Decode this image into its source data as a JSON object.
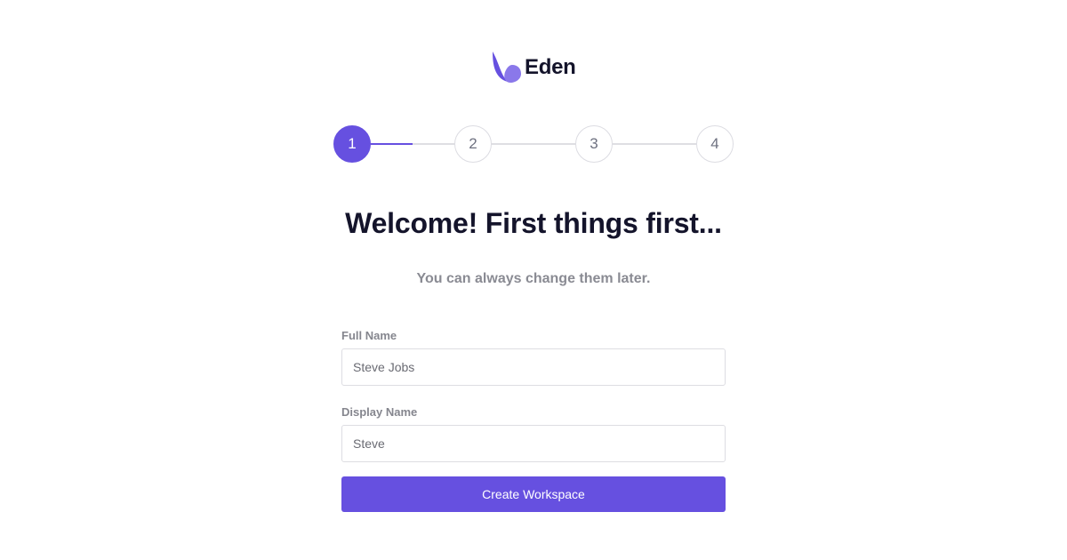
{
  "brand": {
    "name": "Eden",
    "accent_color": "#6650e0",
    "logo_icon": "leaf-logo-icon"
  },
  "stepper": {
    "current_step": 1,
    "progress_fraction_of_first_connector": 0.5,
    "steps": [
      {
        "label": "1"
      },
      {
        "label": "2"
      },
      {
        "label": "3"
      },
      {
        "label": "4"
      }
    ]
  },
  "heading": {
    "title": "Welcome! First things first...",
    "subtitle": "You can always change them later."
  },
  "form": {
    "full_name": {
      "label": "Full Name",
      "value": "Steve Jobs"
    },
    "display_name": {
      "label": "Display Name",
      "value": "Steve"
    },
    "submit_label": "Create Workspace"
  }
}
